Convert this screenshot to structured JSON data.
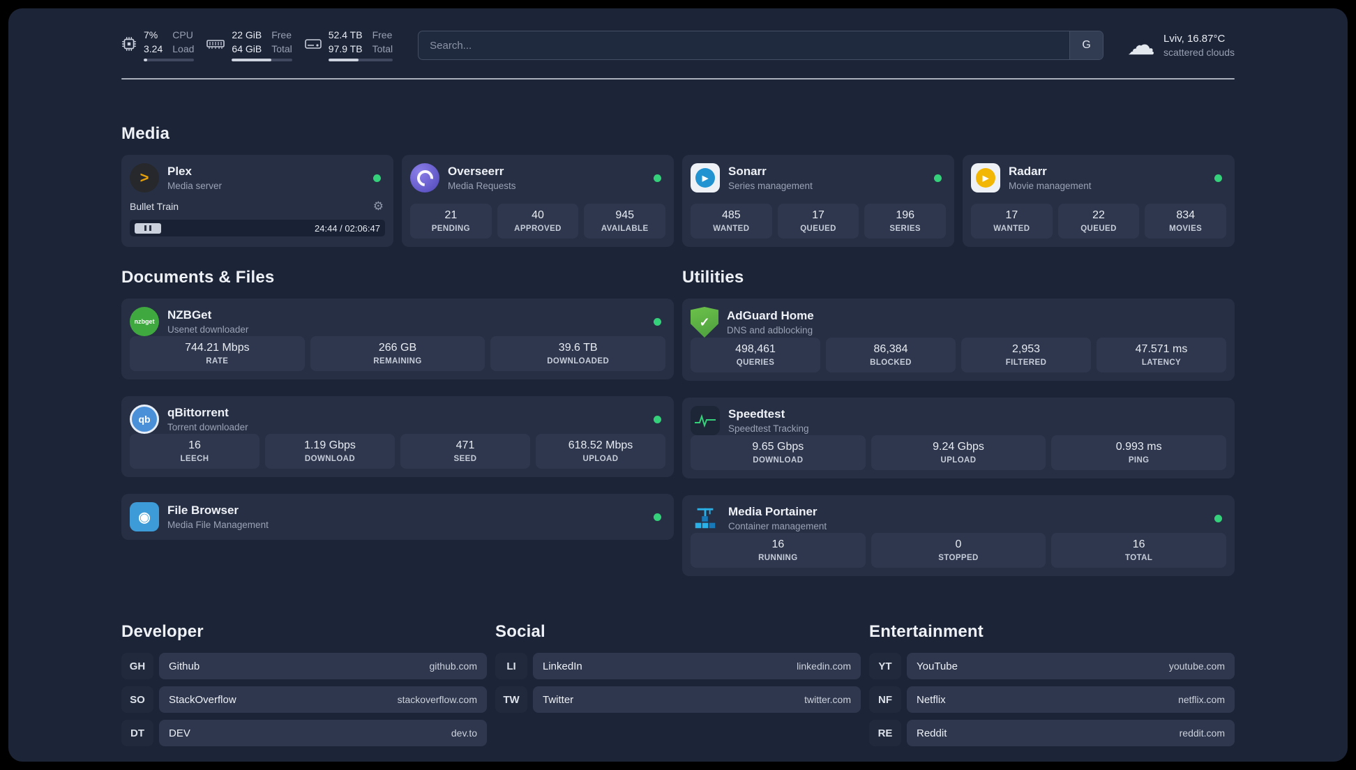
{
  "icons": {
    "gear": "⚙",
    "cloud": "☁"
  },
  "colors": {
    "background": "#1c2437",
    "card": "#272f44",
    "tile": "#2e374e",
    "status_online": "#35d07a",
    "plex_accent": "#e5a00d"
  },
  "topbar": {
    "cpu": {
      "icon": "cpu-chip-icon",
      "values": [
        "7%",
        "3.24"
      ],
      "labels": [
        "CPU",
        "Load"
      ],
      "progress": 7
    },
    "memory": {
      "icon": "memory-icon",
      "values": [
        "22 GiB",
        "64 GiB"
      ],
      "labels": [
        "Free",
        "Total"
      ],
      "progress": 66
    },
    "disk": {
      "icon": "hard-drive-icon",
      "values": [
        "52.4 TB",
        "97.9 TB"
      ],
      "labels": [
        "Free",
        "Total"
      ],
      "progress": 47
    },
    "search": {
      "placeholder": "Search...",
      "engine_button": "G"
    },
    "weather": {
      "location": "Lviv, 16.87°C",
      "condition": "scattered clouds"
    }
  },
  "sections": {
    "media": {
      "title": "Media",
      "apps": [
        {
          "name": "Plex",
          "desc": "Media server",
          "status": "online",
          "icon_glyph": ">",
          "player": {
            "track": "Bullet Train",
            "time": "24:44 / 02:06:47",
            "progress": 19
          }
        },
        {
          "name": "Overseerr",
          "desc": "Media Requests",
          "status": "online",
          "stats": [
            {
              "value": "21",
              "label": "PENDING"
            },
            {
              "value": "40",
              "label": "APPROVED"
            },
            {
              "value": "945",
              "label": "AVAILABLE"
            }
          ]
        },
        {
          "name": "Sonarr",
          "desc": "Series management",
          "status": "online",
          "icon_glyph": "▶",
          "stats": [
            {
              "value": "485",
              "label": "WANTED"
            },
            {
              "value": "17",
              "label": "QUEUED"
            },
            {
              "value": "196",
              "label": "SERIES"
            }
          ]
        },
        {
          "name": "Radarr",
          "desc": "Movie management",
          "status": "online",
          "icon_glyph": "▶",
          "stats": [
            {
              "value": "17",
              "label": "WANTED"
            },
            {
              "value": "22",
              "label": "QUEUED"
            },
            {
              "value": "834",
              "label": "MOVIES"
            }
          ]
        }
      ]
    },
    "documents": {
      "title": "Documents & Files",
      "apps": [
        {
          "name": "NZBGet",
          "desc": "Usenet downloader",
          "status": "online",
          "icon_glyph": "nzbget",
          "stats": [
            {
              "value": "744.21 Mbps",
              "label": "RATE"
            },
            {
              "value": "266 GB",
              "label": "REMAINING"
            },
            {
              "value": "39.6 TB",
              "label": "DOWNLOADED"
            }
          ]
        },
        {
          "name": "qBittorrent",
          "desc": "Torrent downloader",
          "status": "online",
          "icon_glyph": "qb",
          "stats": [
            {
              "value": "16",
              "label": "LEECH"
            },
            {
              "value": "1.19 Gbps",
              "label": "DOWNLOAD"
            },
            {
              "value": "471",
              "label": "SEED"
            },
            {
              "value": "618.52 Mbps",
              "label": "UPLOAD"
            }
          ]
        },
        {
          "name": "File Browser",
          "desc": "Media File Management",
          "status": "online",
          "icon_glyph": "◉"
        }
      ]
    },
    "utilities": {
      "title": "Utilities",
      "apps": [
        {
          "name": "AdGuard Home",
          "desc": "DNS and adblocking",
          "icon_glyph": "✓",
          "stats": [
            {
              "value": "498,461",
              "label": "QUERIES"
            },
            {
              "value": "86,384",
              "label": "BLOCKED"
            },
            {
              "value": "2,953",
              "label": "FILTERED"
            },
            {
              "value": "47.571 ms",
              "label": "LATENCY"
            }
          ]
        },
        {
          "name": "Speedtest",
          "desc": "Speedtest Tracking",
          "stats": [
            {
              "value": "9.65 Gbps",
              "label": "DOWNLOAD"
            },
            {
              "value": "9.24 Gbps",
              "label": "UPLOAD"
            },
            {
              "value": "0.993 ms",
              "label": "PING"
            }
          ]
        },
        {
          "name": "Media Portainer",
          "desc": "Container management",
          "status": "online",
          "stats": [
            {
              "value": "16",
              "label": "RUNNING"
            },
            {
              "value": "0",
              "label": "STOPPED"
            },
            {
              "value": "16",
              "label": "TOTAL"
            }
          ]
        }
      ]
    },
    "bookmarks": [
      {
        "title": "Developer",
        "links": [
          {
            "abbr": "GH",
            "name": "Github",
            "url": "github.com"
          },
          {
            "abbr": "SO",
            "name": "StackOverflow",
            "url": "stackoverflow.com"
          },
          {
            "abbr": "DT",
            "name": "DEV",
            "url": "dev.to"
          }
        ]
      },
      {
        "title": "Social",
        "links": [
          {
            "abbr": "LI",
            "name": "LinkedIn",
            "url": "linkedin.com"
          },
          {
            "abbr": "TW",
            "name": "Twitter",
            "url": "twitter.com"
          }
        ]
      },
      {
        "title": "Entertainment",
        "links": [
          {
            "abbr": "YT",
            "name": "YouTube",
            "url": "youtube.com"
          },
          {
            "abbr": "NF",
            "name": "Netflix",
            "url": "netflix.com"
          },
          {
            "abbr": "RE",
            "name": "Reddit",
            "url": "reddit.com"
          }
        ]
      }
    ]
  }
}
